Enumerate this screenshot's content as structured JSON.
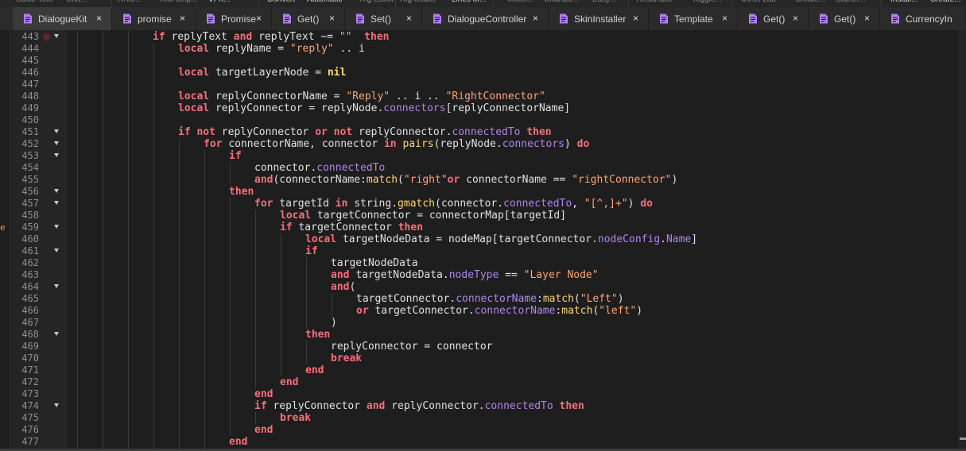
{
  "toolbar": {
    "items": [
      "Scale Text",
      "Unit...",
      "RNG...",
      "Tool Grip...",
      "VFX...",
      "Convert",
      "Automatic",
      "Rig Editor",
      "Rig Scaler",
      "Lines of...",
      "Moon...",
      "Charact...",
      "Easy...",
      "Resurface",
      "Toggle...",
      "Mesh Lab",
      "Create...",
      "Starter...",
      "Install...",
      "Create..."
    ]
  },
  "tabs": [
    {
      "label": "DialogueKit",
      "icon": "script-icon",
      "active": true
    },
    {
      "label": "promise",
      "icon": "script-icon",
      "active": false
    },
    {
      "label": "Promise",
      "icon": "script-icon",
      "active": false
    },
    {
      "label": "Get()",
      "icon": "script-icon",
      "active": false
    },
    {
      "label": "Set()",
      "icon": "script-icon",
      "active": false
    },
    {
      "label": "DialogueController",
      "icon": "module-script-icon",
      "active": false
    },
    {
      "label": "SkinInstaller",
      "icon": "script-icon",
      "active": false
    },
    {
      "label": "Template",
      "icon": "script-icon",
      "active": false
    },
    {
      "label": "Get()",
      "icon": "script-icon",
      "active": false
    },
    {
      "label": "Get()",
      "icon": "script-icon",
      "active": false
    },
    {
      "label": "CurrencyIn",
      "icon": "script-icon",
      "active": false
    }
  ],
  "tab_close_glyph": "×",
  "left_strip_glyph": "e",
  "accent_colors": {
    "keyword": "#f86d7c",
    "string": "#ffa474",
    "nil": "#ffdf58",
    "property": "#b184ec",
    "function": "#ffd277",
    "tab_icon": "#b67cf4"
  },
  "editor": {
    "lines": [
      {
        "n": "443",
        "indent": 3,
        "fold": true,
        "breakpoint": true,
        "tokens": [
          [
            "kw",
            "if"
          ],
          [
            "",
            "replyText "
          ],
          [
            "kw",
            "and"
          ],
          [
            "",
            "replyText ~= "
          ],
          [
            "str",
            "\"\""
          ],
          [
            "",
            "  "
          ],
          [
            "kw",
            "then"
          ]
        ]
      },
      {
        "n": "444",
        "indent": 4,
        "fold": false,
        "tokens": [
          [
            "kw",
            "local"
          ],
          [
            "",
            "replyName = "
          ],
          [
            "str",
            "\"reply\""
          ],
          [
            "",
            " .. i"
          ]
        ]
      },
      {
        "n": "445",
        "indent": 4,
        "fold": false,
        "tokens": []
      },
      {
        "n": "446",
        "indent": 4,
        "fold": false,
        "tokens": [
          [
            "kw",
            "local"
          ],
          [
            "",
            "targetLayerNode = "
          ],
          [
            "nil",
            "nil"
          ]
        ]
      },
      {
        "n": "447",
        "indent": 4,
        "fold": false,
        "tokens": []
      },
      {
        "n": "448",
        "indent": 4,
        "fold": false,
        "tokens": [
          [
            "kw",
            "local"
          ],
          [
            "",
            "replyConnectorName = "
          ],
          [
            "str",
            "\"Reply\""
          ],
          [
            "",
            " .. i .. "
          ],
          [
            "str",
            "\"RightConnector\""
          ]
        ]
      },
      {
        "n": "449",
        "indent": 4,
        "fold": false,
        "tokens": [
          [
            "kw",
            "local"
          ],
          [
            "",
            "replyConnector = replyNode."
          ],
          [
            "prop",
            "connectors"
          ],
          [
            "",
            "[replyConnectorName]"
          ]
        ]
      },
      {
        "n": "450",
        "indent": 4,
        "fold": false,
        "tokens": []
      },
      {
        "n": "451",
        "indent": 4,
        "fold": true,
        "tokens": [
          [
            "kw",
            "if"
          ],
          [
            "kw",
            "not"
          ],
          [
            "",
            "replyConnector "
          ],
          [
            "kw",
            "or"
          ],
          [
            "kw",
            "not"
          ],
          [
            "",
            "replyConnector."
          ],
          [
            "prop",
            "connectedTo"
          ],
          [
            "",
            " "
          ],
          [
            "kw",
            "then"
          ]
        ]
      },
      {
        "n": "452",
        "indent": 5,
        "fold": true,
        "tokens": [
          [
            "kw",
            "for"
          ],
          [
            "",
            "connectorName, connector "
          ],
          [
            "kw",
            "in"
          ],
          [
            "fn",
            "pairs"
          ],
          [
            "",
            "(replyNode."
          ],
          [
            "prop",
            "connectors"
          ],
          [
            "",
            ") "
          ],
          [
            "kw",
            "do"
          ]
        ]
      },
      {
        "n": "453",
        "indent": 6,
        "fold": true,
        "tokens": [
          [
            "kw",
            "if"
          ]
        ]
      },
      {
        "n": "454",
        "indent": 7,
        "fold": false,
        "tokens": [
          [
            "",
            "connector."
          ],
          [
            "prop",
            "connectedTo"
          ]
        ]
      },
      {
        "n": "455",
        "indent": 7,
        "fold": false,
        "tokens": [
          [
            "kw",
            "and"
          ],
          [
            "",
            "(connectorName:"
          ],
          [
            "fn",
            "match"
          ],
          [
            "",
            "("
          ],
          [
            "str",
            "\"right\""
          ],
          [
            ") "
          ],
          [
            "kw",
            "or"
          ],
          [
            "",
            "connectorName == "
          ],
          [
            "str",
            "\"rightConnector\""
          ],
          [
            "",
            ")"
          ]
        ]
      },
      {
        "n": "456",
        "indent": 6,
        "fold": true,
        "tokens": [
          [
            "kw",
            "then"
          ]
        ]
      },
      {
        "n": "457",
        "indent": 7,
        "fold": true,
        "tokens": [
          [
            "kw",
            "for"
          ],
          [
            "",
            "targetId "
          ],
          [
            "kw",
            "in"
          ],
          [
            "",
            "string."
          ],
          [
            "fn",
            "gmatch"
          ],
          [
            "",
            "(connector."
          ],
          [
            "prop",
            "connectedTo"
          ],
          [
            "",
            ", "
          ],
          [
            "str",
            "\"[^,]+\""
          ],
          [
            "",
            ") "
          ],
          [
            "kw",
            "do"
          ]
        ]
      },
      {
        "n": "458",
        "indent": 8,
        "fold": false,
        "tokens": [
          [
            "kw",
            "local"
          ],
          [
            "",
            "targetConnector = connectorMap[targetId]"
          ]
        ]
      },
      {
        "n": "459",
        "indent": 8,
        "fold": true,
        "tokens": [
          [
            "kw",
            "if"
          ],
          [
            "",
            "targetConnector "
          ],
          [
            "kw",
            "then"
          ]
        ]
      },
      {
        "n": "460",
        "indent": 9,
        "fold": false,
        "tokens": [
          [
            "kw",
            "local"
          ],
          [
            "",
            "targetNodeData = nodeMap[targetConnector."
          ],
          [
            "prop",
            "nodeConfig"
          ],
          [
            "",
            "."
          ],
          [
            "prop",
            "Name"
          ],
          [
            "",
            "]"
          ]
        ]
      },
      {
        "n": "461",
        "indent": 9,
        "fold": true,
        "tokens": [
          [
            "kw",
            "if"
          ]
        ]
      },
      {
        "n": "462",
        "indent": 10,
        "fold": false,
        "tokens": [
          [
            "",
            "targetNodeData"
          ]
        ]
      },
      {
        "n": "463",
        "indent": 10,
        "fold": false,
        "tokens": [
          [
            "kw",
            "and"
          ],
          [
            "",
            "targetNodeData."
          ],
          [
            "prop",
            "nodeType"
          ],
          [
            "",
            " == "
          ],
          [
            "str",
            "\"Layer Node\""
          ]
        ]
      },
      {
        "n": "464",
        "indent": 10,
        "fold": true,
        "tokens": [
          [
            "kw",
            "and"
          ],
          [
            "",
            "("
          ]
        ]
      },
      {
        "n": "465",
        "indent": 11,
        "fold": false,
        "tokens": [
          [
            "",
            "targetConnector."
          ],
          [
            "prop",
            "connectorName"
          ],
          [
            "",
            ":"
          ],
          [
            "fn",
            "match"
          ],
          [
            "",
            "("
          ],
          [
            "str",
            "\"Left\""
          ],
          [
            "",
            ")"
          ]
        ]
      },
      {
        "n": "466",
        "indent": 11,
        "fold": false,
        "tokens": [
          [
            "kw",
            "or"
          ],
          [
            "",
            "targetConnector."
          ],
          [
            "prop",
            "connectorName"
          ],
          [
            "",
            ":"
          ],
          [
            "fn",
            "match"
          ],
          [
            "",
            "("
          ],
          [
            "str",
            "\"left\""
          ],
          [
            "",
            ")"
          ]
        ]
      },
      {
        "n": "467",
        "indent": 10,
        "fold": false,
        "tokens": [
          [
            "",
            ")"
          ]
        ]
      },
      {
        "n": "468",
        "indent": 9,
        "fold": true,
        "tokens": [
          [
            "kw",
            "then"
          ]
        ]
      },
      {
        "n": "469",
        "indent": 10,
        "fold": false,
        "tokens": [
          [
            "",
            "replyConnector = connector"
          ]
        ]
      },
      {
        "n": "470",
        "indent": 10,
        "fold": false,
        "tokens": [
          [
            "kw",
            "break"
          ]
        ]
      },
      {
        "n": "471",
        "indent": 9,
        "fold": false,
        "tokens": [
          [
            "kw",
            "end"
          ]
        ]
      },
      {
        "n": "472",
        "indent": 8,
        "fold": false,
        "tokens": [
          [
            "kw",
            "end"
          ]
        ]
      },
      {
        "n": "473",
        "indent": 7,
        "fold": false,
        "tokens": [
          [
            "kw",
            "end"
          ]
        ]
      },
      {
        "n": "474",
        "indent": 7,
        "fold": true,
        "tokens": [
          [
            "kw",
            "if"
          ],
          [
            "",
            "replyConnector "
          ],
          [
            "kw",
            "and"
          ],
          [
            "",
            "replyConnector."
          ],
          [
            "prop",
            "connectedTo"
          ],
          [
            "",
            " "
          ],
          [
            "kw",
            "then"
          ]
        ]
      },
      {
        "n": "475",
        "indent": 8,
        "fold": false,
        "tokens": [
          [
            "kw",
            "break"
          ]
        ]
      },
      {
        "n": "476",
        "indent": 7,
        "fold": false,
        "tokens": [
          [
            "kw",
            "end"
          ]
        ]
      },
      {
        "n": "477",
        "indent": 6,
        "fold": false,
        "tokens": [
          [
            "kw",
            "end"
          ]
        ]
      }
    ]
  }
}
